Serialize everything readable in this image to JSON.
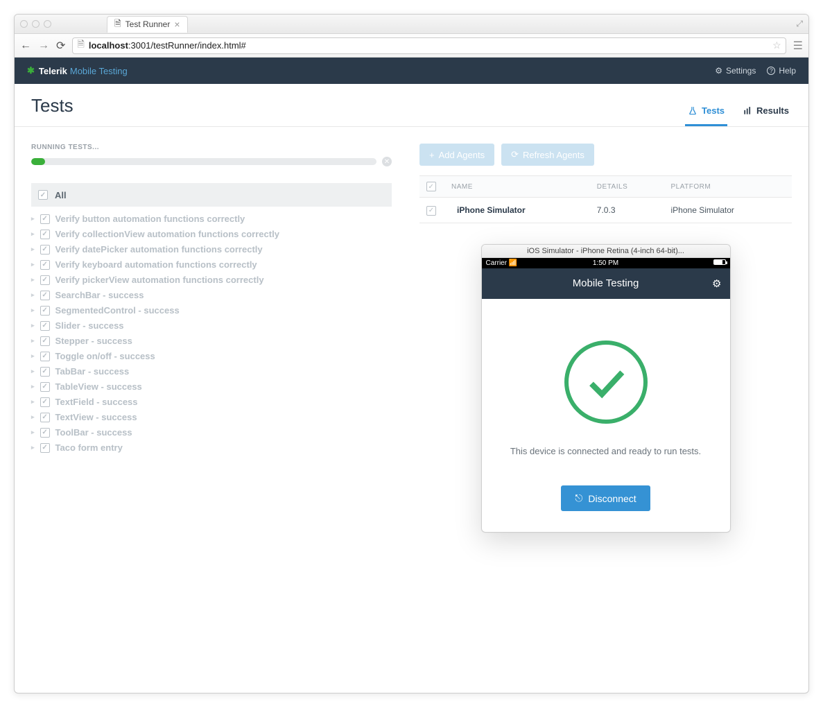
{
  "browser": {
    "tab_title": "Test Runner",
    "url_host": "localhost",
    "url_path": ":3001/testRunner/index.html#"
  },
  "header": {
    "brand_main": "Telerik",
    "brand_sub": "Mobile Testing",
    "settings": "Settings",
    "help": "Help"
  },
  "page": {
    "title": "Tests",
    "tab_tests": "Tests",
    "tab_results": "Results"
  },
  "tests": {
    "running_label": "RUNNING TESTS...",
    "all_label": "All",
    "items": [
      "Verify button automation functions correctly",
      "Verify collectionView automation functions correctly",
      "Verify datePicker automation functions correctly",
      "Verify keyboard automation functions correctly",
      "Verify pickerView automation functions correctly",
      "SearchBar - success",
      "SegmentedControl - success",
      "Slider - success",
      "Stepper - success",
      "Toggle on/off - success",
      "TabBar - success",
      "TableView - success",
      "TextField - success",
      "TextView - success",
      "ToolBar - success",
      "Taco form entry"
    ]
  },
  "agents": {
    "add_btn": "Add Agents",
    "refresh_btn": "Refresh Agents",
    "col_name": "NAME",
    "col_details": "DETAILS",
    "col_platform": "PLATFORM",
    "row_name": "iPhone Simulator",
    "row_details": "7.0.3",
    "row_platform": "iPhone Simulator"
  },
  "sim": {
    "window_title": "iOS Simulator - iPhone Retina (4-inch 64-bit)...",
    "carrier": "Carrier",
    "time": "1:50 PM",
    "nav_title": "Mobile Testing",
    "message": "This device is connected and ready to run tests.",
    "disconnect": "Disconnect"
  }
}
